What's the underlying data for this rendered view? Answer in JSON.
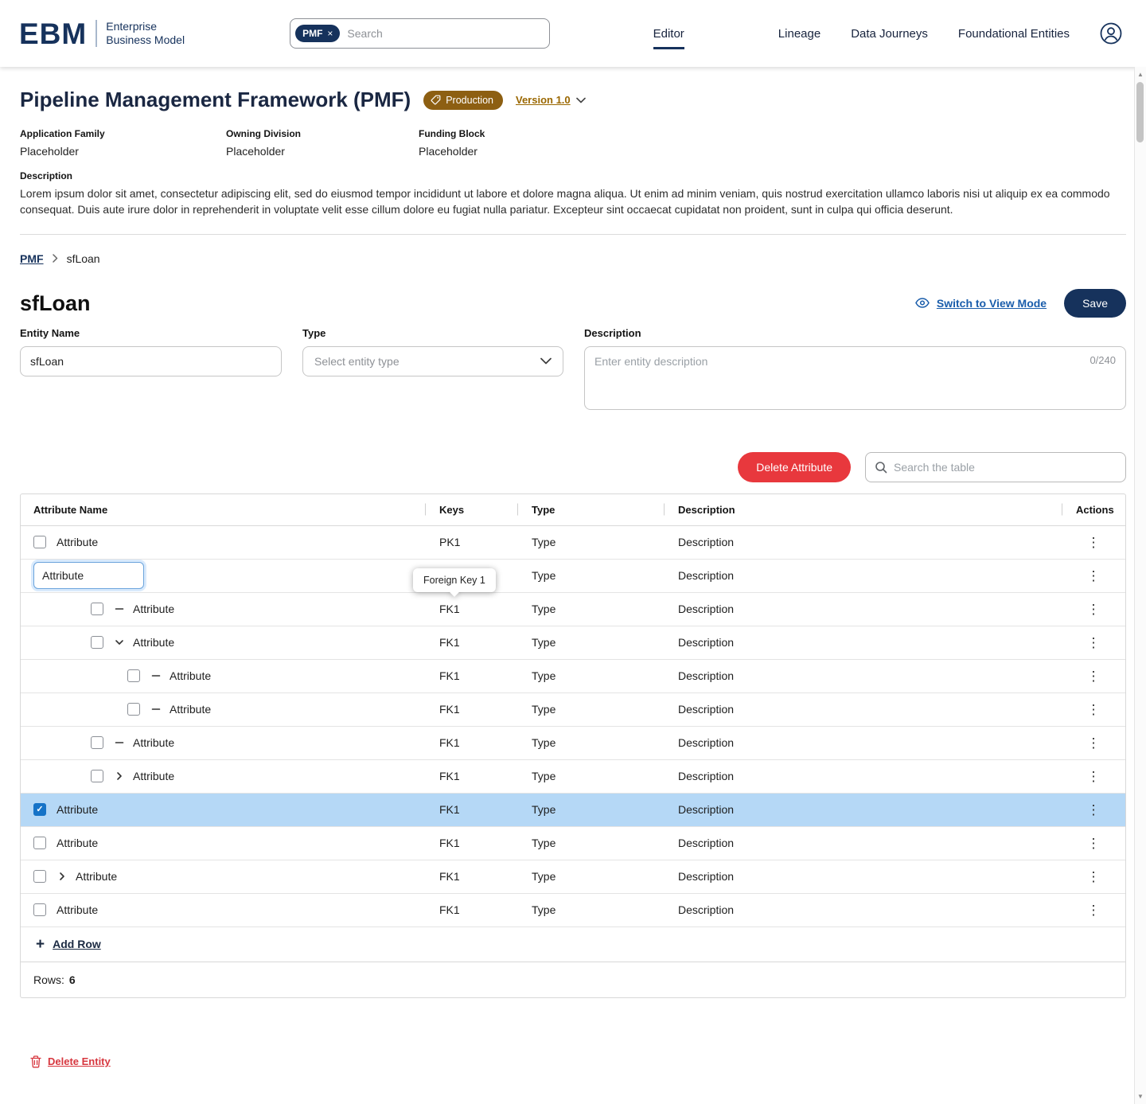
{
  "colors": {
    "navy": "#16325c",
    "accent_red": "#e8383d",
    "selected_row_blue": "#b5d8f6",
    "badge_brown": "#8d5f12",
    "link_blue": "#1a5dab",
    "version_gold": "#9a6700"
  },
  "icons": {
    "kebab": "⋮",
    "add": "+",
    "close": "×",
    "scroll_up": "▲",
    "scroll_down": "▼"
  },
  "header": {
    "logo": {
      "abbr": "EBM",
      "line1": "Enterprise",
      "line2": "Business Model"
    },
    "search": {
      "chip": "PMF",
      "placeholder": "Search"
    },
    "nav": [
      {
        "label": "Editor",
        "active": true
      },
      {
        "label": "Lineage",
        "active": false
      },
      {
        "label": "Data Journeys",
        "active": false
      },
      {
        "label": "Foundational Entities",
        "active": false
      }
    ]
  },
  "page": {
    "title": "Pipeline Management Framework (PMF)",
    "badge": "Production",
    "version": "Version 1.0",
    "meta": [
      {
        "label": "Application Family",
        "value": "Placeholder"
      },
      {
        "label": "Owning Division",
        "value": "Placeholder"
      },
      {
        "label": "Funding Block",
        "value": "Placeholder"
      }
    ],
    "description_label": "Description",
    "description": "Lorem ipsum dolor sit amet, consectetur adipiscing elit, sed do eiusmod tempor incididunt ut labore et dolore magna aliqua. Ut enim ad minim veniam, quis nostrud exercitation ullamco laboris nisi ut aliquip ex ea commodo consequat. Duis aute irure dolor in reprehenderit in voluptate velit esse cillum dolore eu fugiat nulla pariatur. Excepteur sint occaecat cupidatat non proident, sunt in culpa qui officia deserunt."
  },
  "breadcrumb": {
    "root": "PMF",
    "current": "sfLoan"
  },
  "entity": {
    "title": "sfLoan",
    "switch_view_label": "Switch to View Mode",
    "save_label": "Save",
    "name_label": "Entity Name",
    "name_value": "sfLoan",
    "type_label": "Type",
    "type_placeholder": "Select entity type",
    "description_label": "Description",
    "description_placeholder": "Enter entity description",
    "char_counter": "0/240"
  },
  "table": {
    "delete_attribute_label": "Delete Attribute",
    "search_placeholder": "Search the table",
    "columns": [
      "Attribute Name",
      "Keys",
      "Type",
      "Description",
      "Actions"
    ],
    "tooltip": "Foreign Key 1",
    "rows": [
      {
        "name": "Attribute",
        "key": "PK1",
        "type": "Type",
        "description": "Description",
        "indent": 0,
        "icon": "none",
        "checked": false,
        "selected": false,
        "editing": false
      },
      {
        "name": "Attribute",
        "key": "",
        "type": "Type",
        "description": "Description",
        "indent": 0,
        "icon": "none",
        "checked": false,
        "selected": false,
        "editing": true
      },
      {
        "name": "Attribute",
        "key": "FK1",
        "type": "Type",
        "description": "Description",
        "indent": 1,
        "icon": "minus",
        "checked": false,
        "selected": false,
        "editing": false
      },
      {
        "name": "Attribute",
        "key": "FK1",
        "type": "Type",
        "description": "Description",
        "indent": 1,
        "icon": "chevron-down",
        "checked": false,
        "selected": false,
        "editing": false
      },
      {
        "name": "Attribute",
        "key": "FK1",
        "type": "Type",
        "description": "Description",
        "indent": 2,
        "icon": "minus",
        "checked": false,
        "selected": false,
        "editing": false
      },
      {
        "name": "Attribute",
        "key": "FK1",
        "type": "Type",
        "description": "Description",
        "indent": 2,
        "icon": "minus",
        "checked": false,
        "selected": false,
        "editing": false
      },
      {
        "name": "Attribute",
        "key": "FK1",
        "type": "Type",
        "description": "Description",
        "indent": 1,
        "icon": "minus",
        "checked": false,
        "selected": false,
        "editing": false
      },
      {
        "name": "Attribute",
        "key": "FK1",
        "type": "Type",
        "description": "Description",
        "indent": 1,
        "icon": "chevron-right",
        "checked": false,
        "selected": false,
        "editing": false
      },
      {
        "name": "Attribute",
        "key": "FK1",
        "type": "Type",
        "description": "Description",
        "indent": 0,
        "icon": "none",
        "checked": true,
        "selected": true,
        "editing": false
      },
      {
        "name": "Attribute",
        "key": "FK1",
        "type": "Type",
        "description": "Description",
        "indent": 0,
        "icon": "none",
        "checked": false,
        "selected": false,
        "editing": false
      },
      {
        "name": "Attribute",
        "key": "FK1",
        "type": "Type",
        "description": "Description",
        "indent": 0,
        "icon": "chevron-right",
        "checked": false,
        "selected": false,
        "editing": false
      },
      {
        "name": "Attribute",
        "key": "FK1",
        "type": "Type",
        "description": "Description",
        "indent": 0,
        "icon": "none",
        "checked": false,
        "selected": false,
        "editing": false
      }
    ],
    "add_row_label": "Add Row",
    "rows_label": "Rows:",
    "rows_count": "6"
  },
  "footer": {
    "delete_entity_label": "Delete Entity"
  }
}
